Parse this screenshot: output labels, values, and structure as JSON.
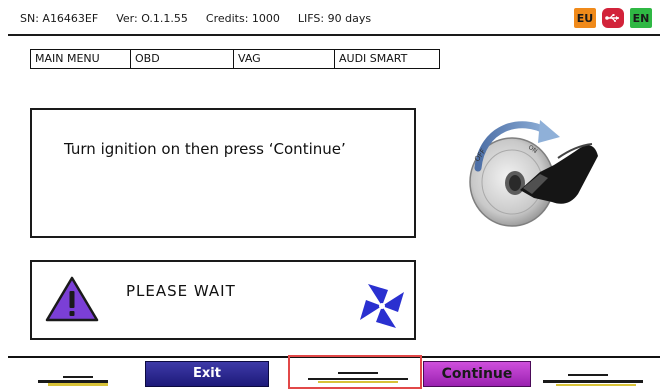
{
  "status_bar": {
    "serial": "SN: A16463EF",
    "version": "Ver: O.1.1.55",
    "credits": "Credits: 1000",
    "lifs": "LIFS: 90 days",
    "region_flag": "EU",
    "language_flag": "EN",
    "colors": {
      "eu": "#f08a1a",
      "usb": "#d2233a",
      "en": "#2fb844"
    }
  },
  "breadcrumb": [
    "MAIN MENU",
    "OBD",
    "VAG",
    "AUDI SMART"
  ],
  "instruction": {
    "text": "Turn ignition on then press ‘Continue’",
    "illustration": "ignition-key-icon",
    "key_labels": {
      "off": "OFF",
      "on": "ON"
    }
  },
  "status_panel": {
    "text": "PLEASE WAIT",
    "warning_icon": "warning-triangle-icon",
    "busy_icon": "spinner-fan-icon",
    "accent_color": "#7b3fd6",
    "spinner_color": "#2a30d0"
  },
  "footer": {
    "exit_label": "Exit",
    "continue_label": "Continue",
    "exit_color": "#2a279a",
    "continue_color": "#b93bc9"
  }
}
